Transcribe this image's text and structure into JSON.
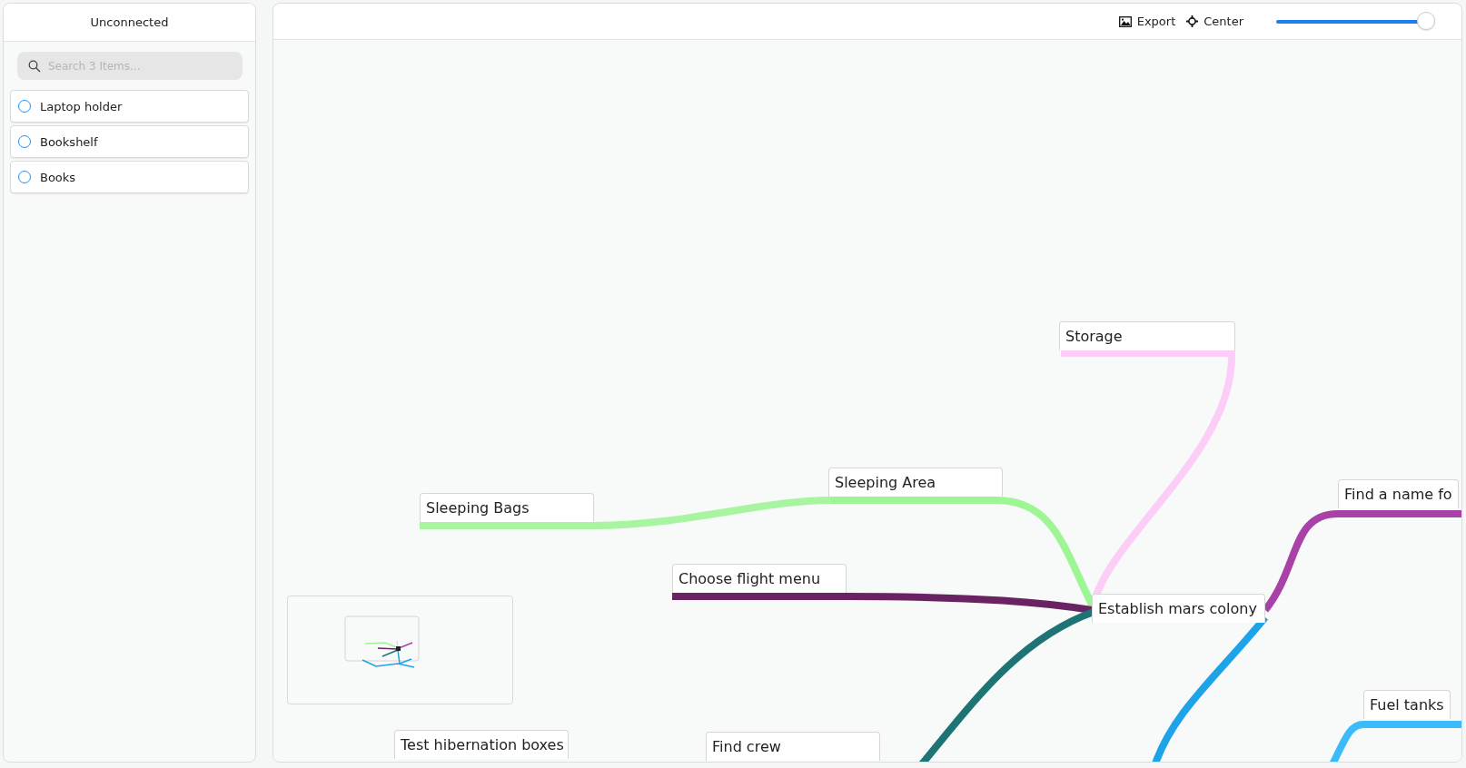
{
  "sidebar": {
    "title": "Unconnected",
    "search": {
      "placeholder": "Search 3 Items..."
    },
    "items": [
      {
        "label": "Laptop holder",
        "checked": false
      },
      {
        "label": "Bookshelf",
        "checked": false
      },
      {
        "label": "Books",
        "checked": false
      }
    ]
  },
  "toolbar": {
    "buttons": [
      {
        "kind": "export",
        "label": "Export"
      },
      {
        "kind": "center",
        "label": "Center"
      }
    ],
    "zoom": {
      "level": 0.97
    }
  },
  "nodes": [
    {
      "label": "Storage"
    },
    {
      "label": "Sleeping Area"
    },
    {
      "label": "Sleeping Bags"
    },
    {
      "label": "Choose flight menu"
    },
    {
      "label": "Establish mars colony"
    },
    {
      "label": "Find a name fo"
    },
    {
      "label": "Fuel tanks"
    },
    {
      "label": "Test hibernation boxes"
    },
    {
      "label": "Find crew"
    }
  ],
  "connectors": [
    {
      "color": "#fbcdf7"
    },
    {
      "color": "#9ef593"
    },
    {
      "color": "#a8f4a0"
    },
    {
      "color": "#692363"
    },
    {
      "color": "#1e7474"
    },
    {
      "color": "#a842a6"
    },
    {
      "color": "#1ca3e8"
    },
    {
      "color": "#3bbcf8"
    }
  ]
}
